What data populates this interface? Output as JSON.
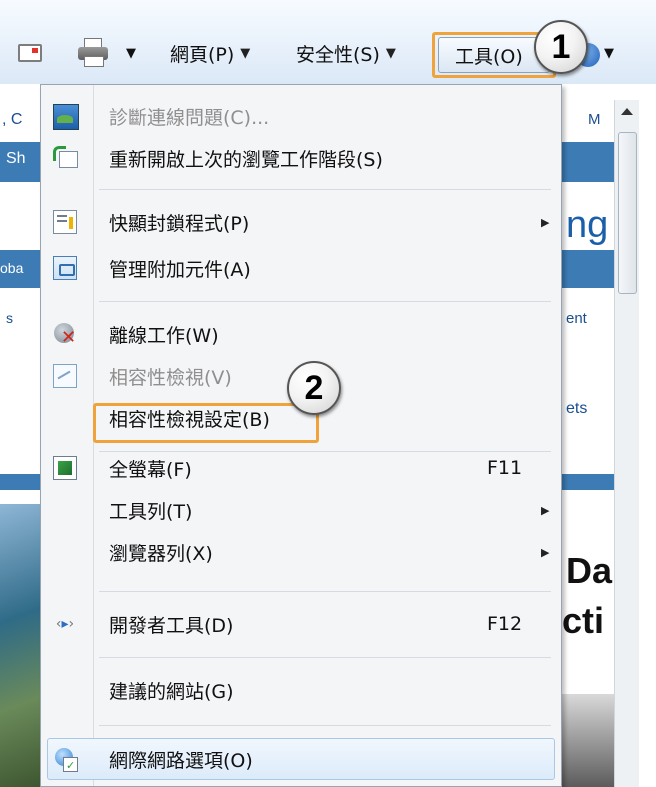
{
  "toolbar": {
    "page_label": "網頁(P)",
    "safety_label": "安全性(S)",
    "tools_label": "工具(O)",
    "arrow": "▼"
  },
  "callouts": {
    "one": "1",
    "two": "2"
  },
  "background_page": {
    "left_snips": [
      ", C",
      "Sh",
      "oba",
      "s"
    ],
    "right_snips": [
      "M",
      "ng",
      "ent",
      "ets",
      "Da",
      "cti"
    ]
  },
  "menu": {
    "items": [
      {
        "label": "診斷連線問題(C)...",
        "disabled": true,
        "icon": "diagnose-icon"
      },
      {
        "label": "重新開啟上次的瀏覽工作階段(S)",
        "disabled": false,
        "icon": "reopen-session-icon"
      },
      {
        "label": "快顯封鎖程式(P)",
        "disabled": false,
        "icon": "popup-blocker-icon",
        "submenu": true
      },
      {
        "label": "管理附加元件(A)",
        "disabled": false,
        "icon": "manage-addons-icon"
      },
      {
        "label": "離線工作(W)",
        "disabled": false,
        "icon": "offline-icon"
      },
      {
        "label": "相容性檢視(V)",
        "disabled": true,
        "icon": "compatibility-view-icon"
      },
      {
        "label": "相容性檢視設定(B)",
        "disabled": false
      },
      {
        "label": "全螢幕(F)",
        "disabled": false,
        "icon": "fullscreen-icon",
        "shortcut": "F11"
      },
      {
        "label": "工具列(T)",
        "disabled": false,
        "submenu": true
      },
      {
        "label": "瀏覽器列(X)",
        "disabled": false,
        "submenu": true
      },
      {
        "label": "開發者工具(D)",
        "disabled": false,
        "icon": "developer-tools-icon",
        "shortcut": "F12"
      },
      {
        "label": "建議的網站(G)",
        "disabled": false
      },
      {
        "label": "網際網路選項(O)",
        "disabled": false,
        "icon": "internet-options-icon"
      }
    ],
    "submenu_arrow": "▶"
  },
  "colors": {
    "highlight_orange": "#f0a33a",
    "accent_blue": "#3c7bb4"
  }
}
